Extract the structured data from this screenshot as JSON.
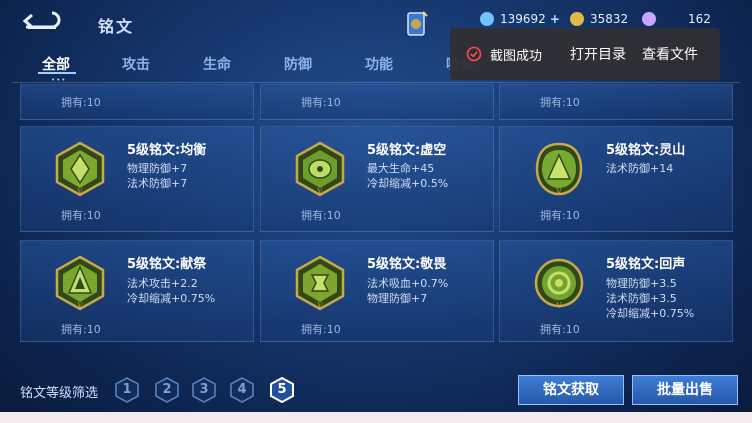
{
  "header": {
    "title": "铭文",
    "resources": [
      {
        "icon": "diamond-icon",
        "value": "139692",
        "plus": "+"
      },
      {
        "icon": "gold-coin-icon",
        "value": "35832"
      },
      {
        "icon": "crystal-icon",
        "value": "162"
      }
    ]
  },
  "tabs": [
    {
      "label": "全部",
      "active": true
    },
    {
      "label": "攻击",
      "active": false
    },
    {
      "label": "生命",
      "active": false
    },
    {
      "label": "防御",
      "active": false
    },
    {
      "label": "功能",
      "active": false
    },
    {
      "label": "吸血",
      "active": false
    }
  ],
  "top_row_owned": [
    "拥有:10",
    "拥有:10",
    "拥有:10"
  ],
  "runes": [
    {
      "name": "5级铭文:均衡",
      "attrs": [
        "物理防御+7",
        "法术防御+7"
      ],
      "owned": "拥有:10",
      "color": "#7da82f"
    },
    {
      "name": "5级铭文:虚空",
      "attrs": [
        "最大生命+45",
        "冷却缩减+0.5%"
      ],
      "owned": "拥有:10",
      "color": "#6f9d2c"
    },
    {
      "name": "5级铭文:灵山",
      "attrs": [
        "法术防御+14"
      ],
      "owned": "拥有:10",
      "color": "#7aa932"
    },
    {
      "name": "5级铭文:献祭",
      "attrs": [
        "法术攻击+2.2",
        "冷却缩减+0.75%"
      ],
      "owned": "拥有:10",
      "color": "#78a62f"
    },
    {
      "name": "5级铭文:敬畏",
      "attrs": [
        "法术吸血+0.7%",
        "物理防御+7"
      ],
      "owned": "拥有:10",
      "color": "#7ea52d"
    },
    {
      "name": "5级铭文:回声",
      "attrs": [
        "物理防御+3.5",
        "法术防御+3.5",
        "冷却缩减+0.75%"
      ],
      "owned": "拥有:10",
      "color": "#74a42f"
    }
  ],
  "filter": {
    "label": "铭文等级筛选",
    "levels": [
      "1",
      "2",
      "3",
      "4",
      "5"
    ],
    "selected": "5"
  },
  "buttons": {
    "acquire": "铭文获取",
    "bulk_sell": "批量出售"
  },
  "toast": {
    "message": "截图成功",
    "open_dir": "打开目录",
    "view_file": "查看文件"
  },
  "colors": {
    "accent": "#3f7dd6",
    "gold": "#c8a84a",
    "toast_bg": "#303034",
    "toast_icon": "#ff4a5a"
  }
}
